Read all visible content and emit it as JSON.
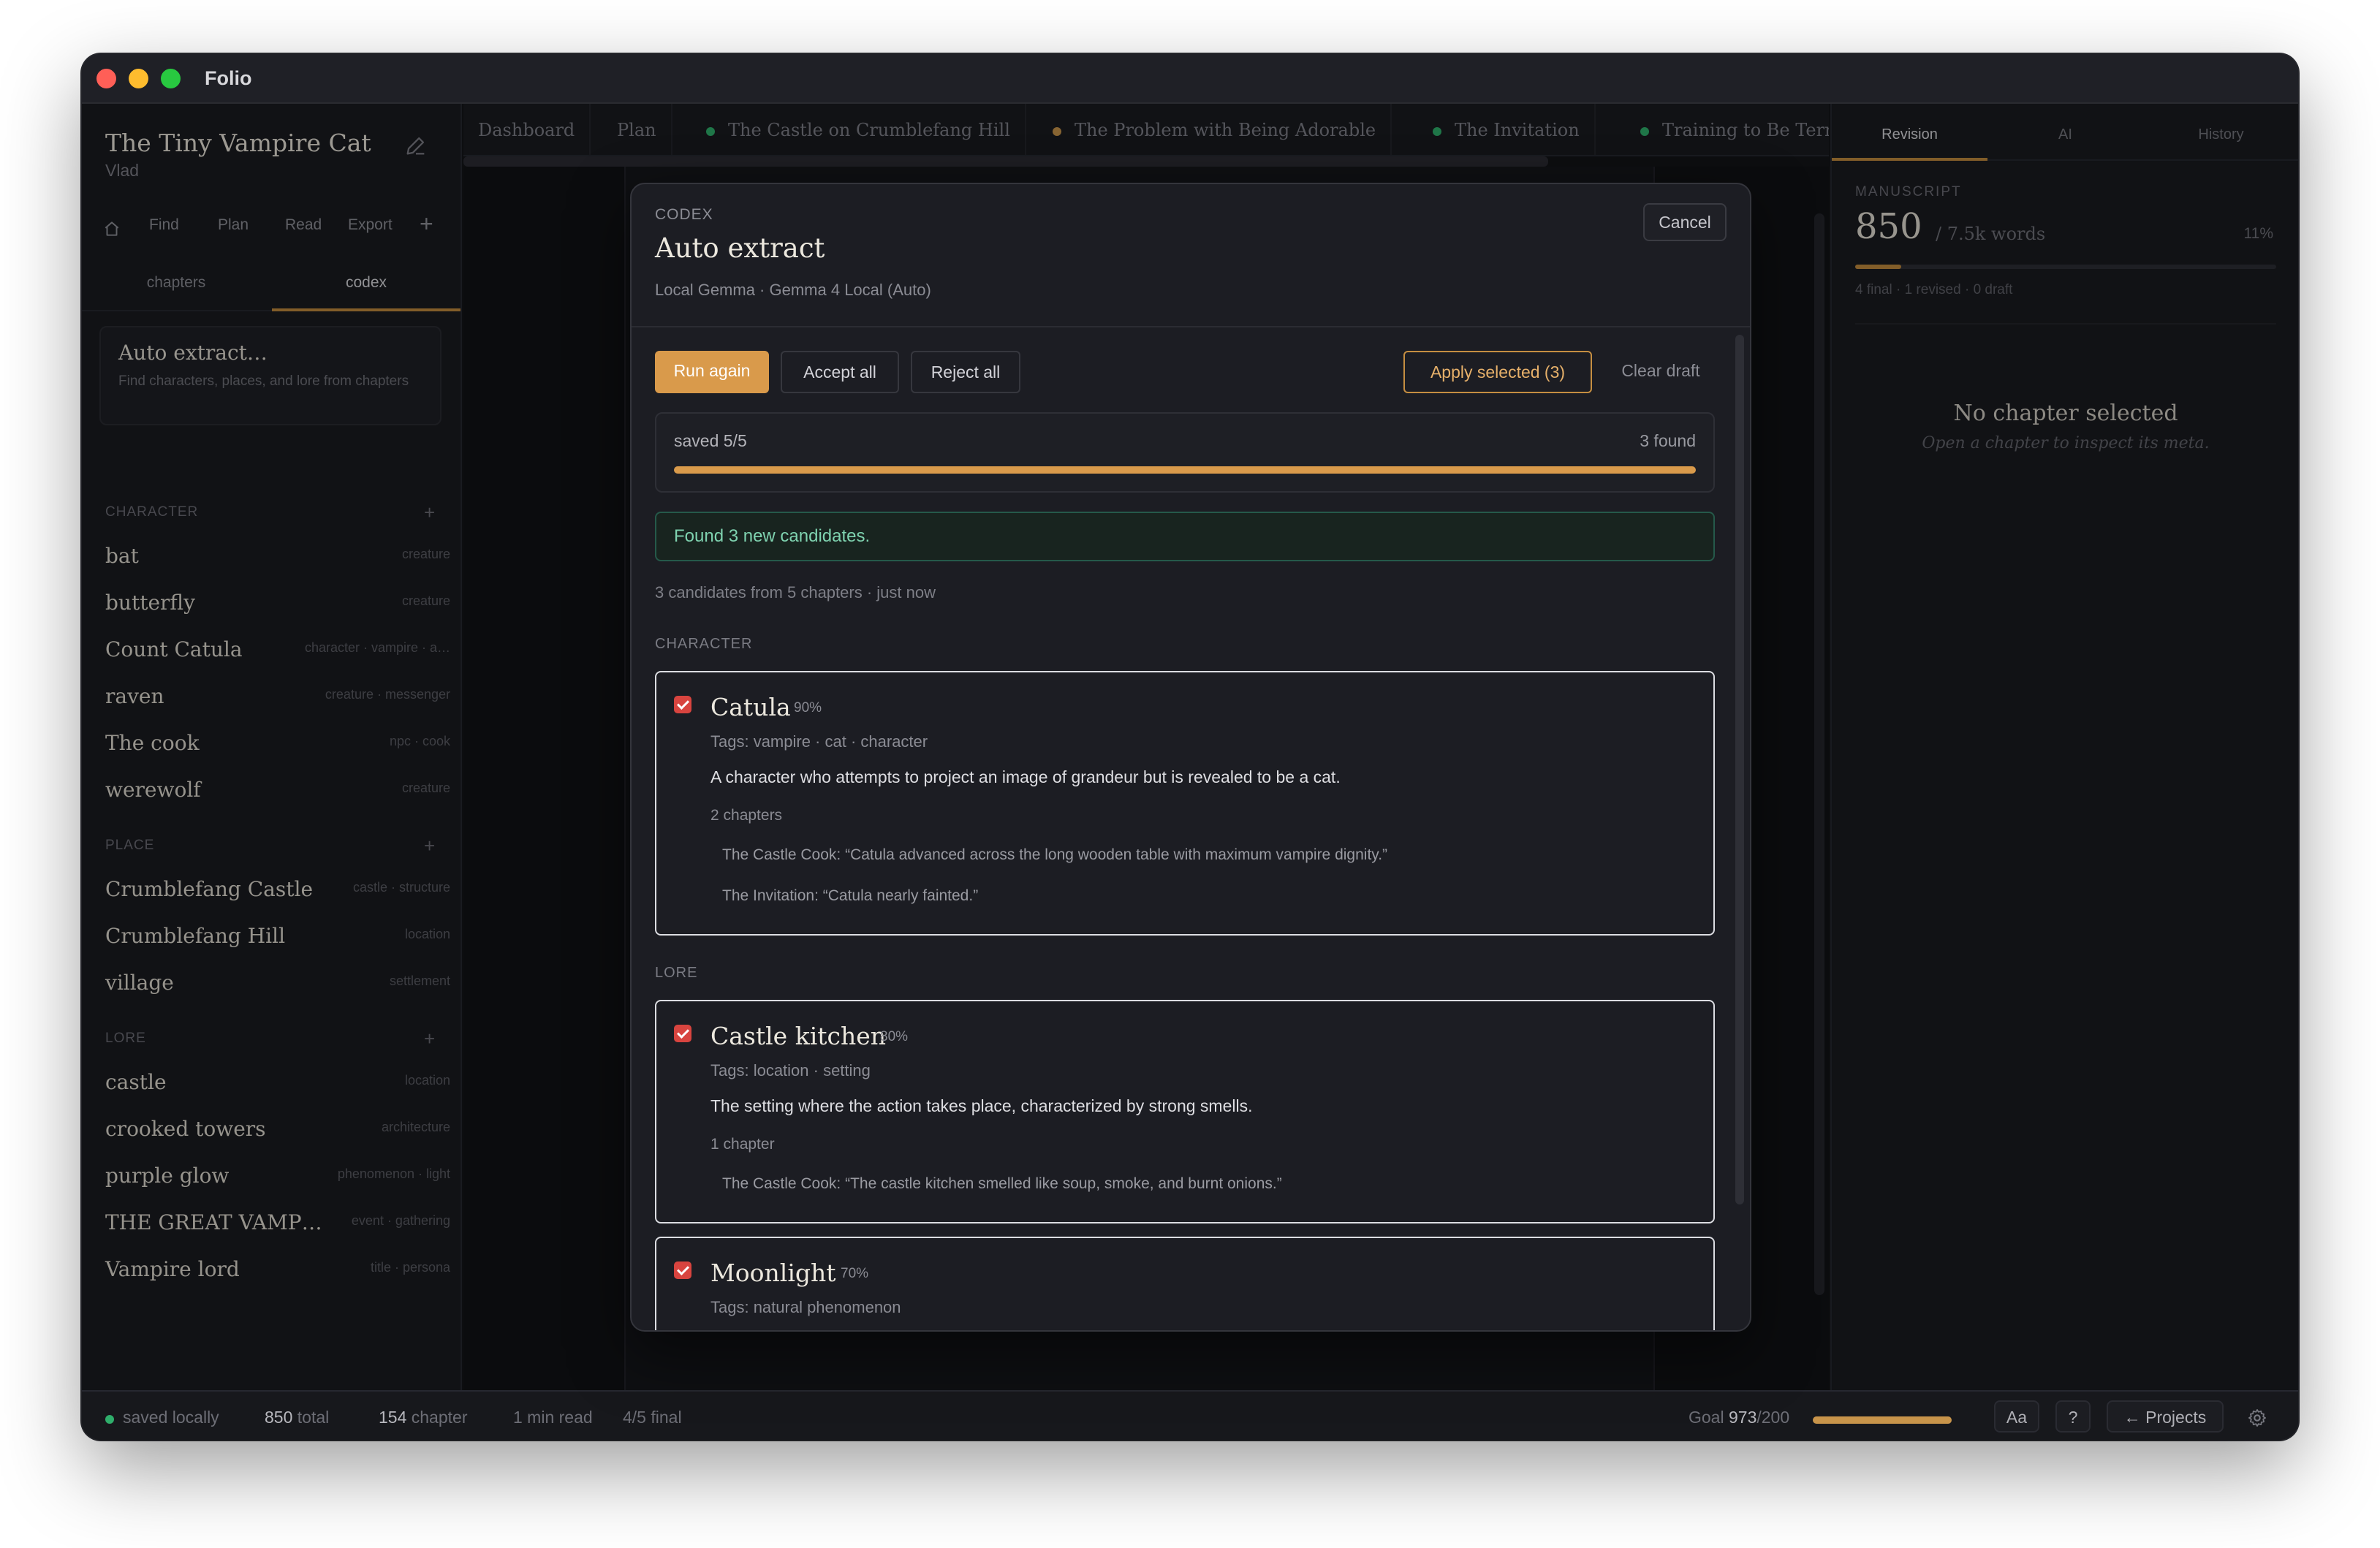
{
  "window": {
    "app_title": "Folio"
  },
  "sidebar": {
    "project_title": "The Tiny Vampire Cat",
    "author": "Vlad",
    "nav": [
      "Find",
      "Plan",
      "Read",
      "Export"
    ],
    "subtabs": [
      "chapters",
      "codex"
    ],
    "auto_extract": {
      "title": "Auto extract…",
      "desc": "Find characters, places, and lore from chapters"
    },
    "sections": [
      {
        "head": "CHARACTER",
        "entries": [
          {
            "name": "bat",
            "tag": "creature"
          },
          {
            "name": "butterfly",
            "tag": "creature"
          },
          {
            "name": "Count Catula",
            "tag": "character · vampire · a…"
          },
          {
            "name": "raven",
            "tag": "creature · messenger"
          },
          {
            "name": "The cook",
            "tag": "npc · cook"
          },
          {
            "name": "werewolf",
            "tag": "creature"
          }
        ]
      },
      {
        "head": "PLACE",
        "entries": [
          {
            "name": "Crumblefang Castle",
            "tag": "castle · structure"
          },
          {
            "name": "Crumblefang Hill",
            "tag": "location"
          },
          {
            "name": "village",
            "tag": "settlement"
          }
        ]
      },
      {
        "head": "LORE",
        "entries": [
          {
            "name": "castle",
            "tag": "location"
          },
          {
            "name": "crooked towers",
            "tag": "architecture"
          },
          {
            "name": "purple glow",
            "tag": "phenomenon · light"
          },
          {
            "name": "THE GREAT VAMP…",
            "tag": "event · gathering"
          },
          {
            "name": "Vampire lord",
            "tag": "title · persona"
          }
        ]
      }
    ]
  },
  "tabs": [
    {
      "label": "Dashboard",
      "dot": ""
    },
    {
      "label": "Plan",
      "dot": ""
    },
    {
      "label": "The Castle on Crumblefang Hill",
      "dot": "#2fae6b"
    },
    {
      "label": "The Problem with Being Adorable",
      "dot": "#c8944a"
    },
    {
      "label": "The Invitation",
      "dot": "#2fae6b"
    },
    {
      "label": "Training to Be Terrifying",
      "dot": "#2fae6b"
    }
  ],
  "right_panel": {
    "tabs": [
      "Revision",
      "AI",
      "History"
    ],
    "manuscript_label": "MANUSCRIPT",
    "word_count": "850",
    "word_goal": "/ 7.5k words",
    "percent": "11%",
    "progress": 0.11,
    "status_line": "4 final · 1 revised · 0 draft",
    "empty_title": "No chapter selected",
    "empty_sub": "Open a chapter to inspect its meta."
  },
  "statusbar": {
    "saved": "saved locally",
    "total_num": "850",
    "total_label": "total",
    "chapter_num": "154",
    "chapter_label": "chapter",
    "read": "1 min read",
    "final": "4/5 final",
    "goal_label": "Goal",
    "goal_num": "973",
    "goal_den": "/200",
    "goal_progress": 1.0,
    "font_btn": "Aa",
    "help_btn": "?",
    "projects_btn": "← Projects"
  },
  "modal": {
    "label": "CODEX",
    "title": "Auto extract",
    "subtitle": "Local Gemma · Gemma 4 Local (Auto)",
    "cancel": "Cancel",
    "run_again": "Run again",
    "accept_all": "Accept all",
    "reject_all": "Reject all",
    "apply_selected": "Apply selected (3)",
    "clear_draft": "Clear draft",
    "progress_left": "saved 5/5",
    "progress_right": "3 found",
    "progress": 1.0,
    "found_msg": "Found 3 new candidates.",
    "candidates_meta": "3 candidates from 5 chapters · just now",
    "groups": [
      {
        "head": "CHARACTER",
        "cards": [
          {
            "name": "Catula",
            "conf": "90%",
            "tags": "Tags: vampire · cat · character",
            "desc": "A character who attempts to project an image of grandeur but is revealed to be a cat.",
            "count": "2 chapters",
            "quotes": [
              "The Castle Cook: “Catula advanced across the long wooden table with maximum vampire dignity.”",
              "The Invitation: “Catula nearly fainted.”"
            ]
          }
        ]
      },
      {
        "head": "LORE",
        "cards": [
          {
            "name": "Castle kitchen",
            "conf": "80%",
            "tags": "Tags: location · setting",
            "desc": "The setting where the action takes place, characterized by strong smells.",
            "count": "1 chapter",
            "quotes": [
              "The Castle Cook: “The castle kitchen smelled like soup, smoke, and burnt onions.”"
            ]
          },
          {
            "name": "Moonlight",
            "conf": "70%",
            "tags": "Tags: natural phenomenon"
          }
        ]
      }
    ]
  }
}
